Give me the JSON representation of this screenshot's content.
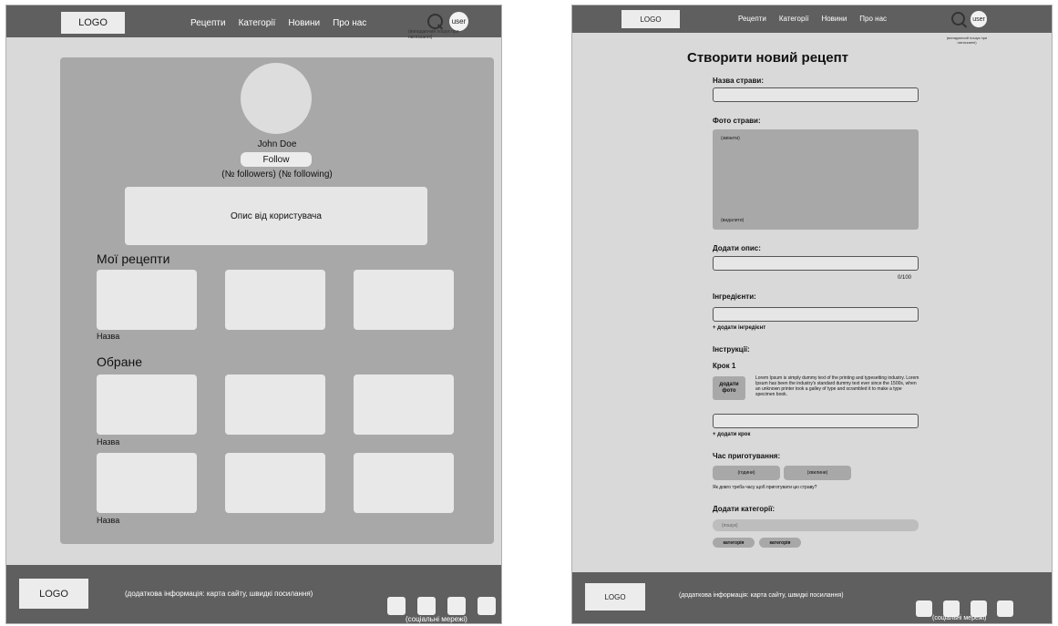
{
  "header": {
    "logo": "LOGO",
    "nav": [
      "Рецепти",
      "Категорії",
      "Новини",
      "Про нас"
    ],
    "user": "user",
    "search_note": "(випадаючий пошук при натисканні)"
  },
  "footer": {
    "logo": "LOGO",
    "info": "(додаткова інформація: карта сайту, швидкі посилання)",
    "social_label": "(соціальні мережі)"
  },
  "profile": {
    "name": "John Doe",
    "follow_label": "Follow",
    "stats": "(№ followers) (№ following)",
    "description": "Опис від користувача",
    "my_recipes_title": "Мої рецепти",
    "favorites_title": "Обране",
    "card_label": "Назва"
  },
  "recipe_form": {
    "title": "Створити новий рецепт",
    "dish_name_label": "Назва страви:",
    "photo_label": "Фото страви:",
    "photo_change": "(змінити)",
    "photo_delete": "(видалити)",
    "description_label": "Додати опис:",
    "description_counter": "0/100",
    "ingredients_label": "Інгредієнти:",
    "add_ingredient": "+ додати інгредієнт",
    "instructions_label": "Інструкції:",
    "step_label": "Крок 1",
    "add_photo": "додати фото",
    "step_text": "Lorem Ipsum is simply dummy text of the printing and typesetting industry. Lorem Ipsum has been the industry's standard dummy text ever since the 1500s, when an unknown printer took a galley of type and scrambled it to make a type specimen book.",
    "add_step": "+ додати крок",
    "cook_time_label": "Час приготування:",
    "hours": "(години)",
    "minutes": "(хвилини)",
    "time_hint": "Як довго треба часу щоб приготувати цю страву?",
    "categories_label": "Додати категорії:",
    "category_search": "(пошук)",
    "categories": [
      "категорія",
      "категорія"
    ]
  }
}
